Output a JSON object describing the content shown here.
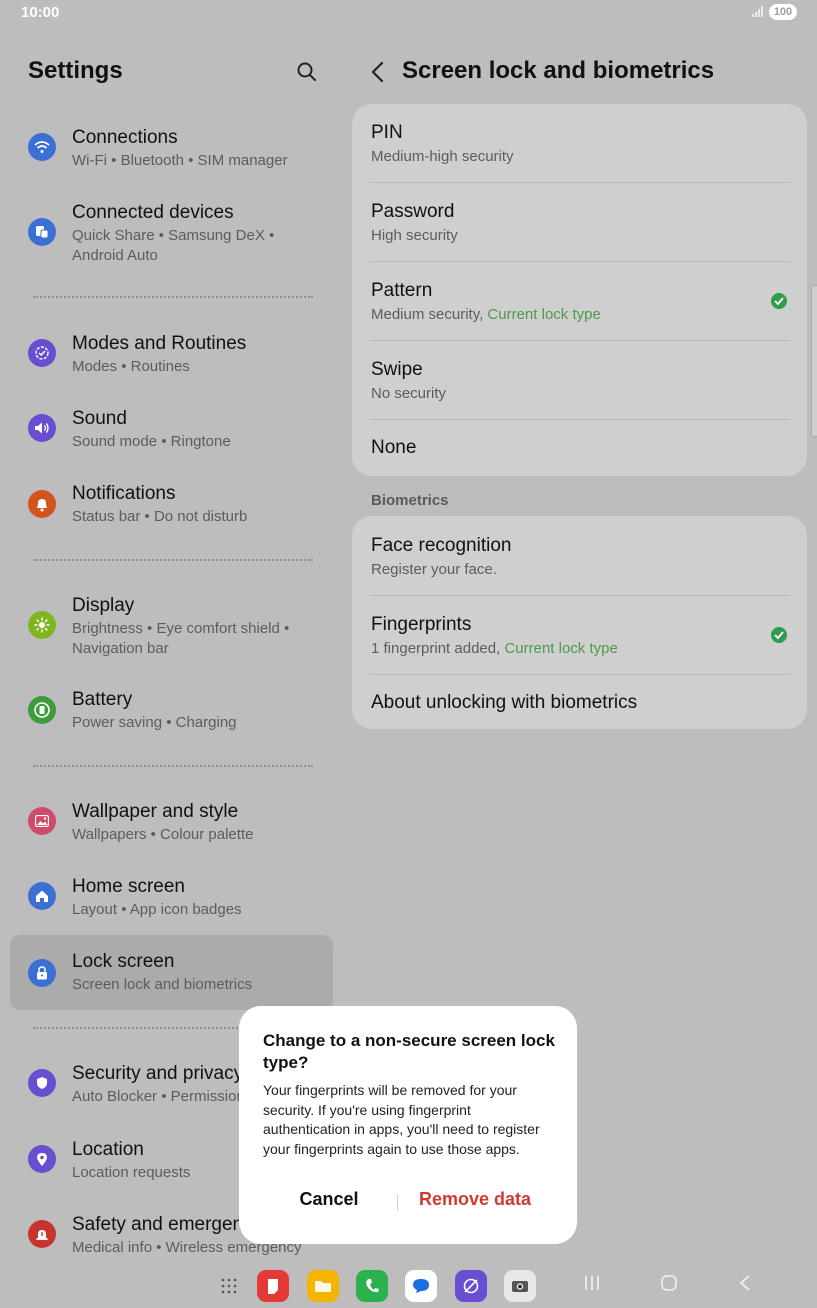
{
  "status_bar": {
    "time": "10:00",
    "battery": "100"
  },
  "left": {
    "title": "Settings",
    "items": [
      {
        "title": "Connections",
        "subtitle": "Wi-Fi  •  Bluetooth  •  SIM manager",
        "icon": "wifi-icon",
        "color": "#3b6fd4"
      },
      {
        "title": "Connected devices",
        "subtitle": "Quick Share  •  Samsung DeX  •  Android Auto",
        "icon": "devices-icon",
        "color": "#3b6fd4"
      },
      {
        "title": "Modes and Routines",
        "subtitle": "Modes  •  Routines",
        "icon": "routines-icon",
        "color": "#6a4ed1"
      },
      {
        "title": "Sound",
        "subtitle": "Sound mode  •  Ringtone",
        "icon": "speaker-icon",
        "color": "#6a4ed1"
      },
      {
        "title": "Notifications",
        "subtitle": "Status bar  •  Do not disturb",
        "icon": "bell-icon",
        "color": "#d4541f"
      },
      {
        "title": "Display",
        "subtitle": "Brightness  •  Eye comfort shield  •  Navigation bar",
        "icon": "sun-icon",
        "color": "#7fb51f"
      },
      {
        "title": "Battery",
        "subtitle": "Power saving  •  Charging",
        "icon": "battery-icon",
        "color": "#3d9a3d"
      },
      {
        "title": "Wallpaper and style",
        "subtitle": "Wallpapers  •  Colour palette",
        "icon": "wallpaper-icon",
        "color": "#d14a6a"
      },
      {
        "title": "Home screen",
        "subtitle": "Layout  •  App icon badges",
        "icon": "home-icon",
        "color": "#3b6fd4"
      },
      {
        "title": "Lock screen",
        "subtitle": "Screen lock and biometrics",
        "icon": "lock-icon",
        "color": "#3b6fd4"
      },
      {
        "title": "Security and privacy",
        "subtitle": "Auto Blocker  •  Permissions",
        "icon": "shield-icon",
        "color": "#6a4ed1"
      },
      {
        "title": "Location",
        "subtitle": "Location requests",
        "icon": "location-pin-icon",
        "color": "#6a4ed1"
      },
      {
        "title": "Safety and emergency",
        "subtitle": "Medical info  •  Wireless emergency",
        "icon": "emergency-icon",
        "color": "#c7342e"
      }
    ]
  },
  "right": {
    "title": "Screen lock and biometrics",
    "lock_types": [
      {
        "title": "PIN",
        "subtitle": "Medium-high security"
      },
      {
        "title": "Password",
        "subtitle": "High security"
      },
      {
        "title": "Pattern",
        "subtitle": "Medium security, ",
        "accent": "Current lock type"
      },
      {
        "title": "Swipe",
        "subtitle": "No security"
      },
      {
        "title": "None"
      }
    ],
    "biometrics_label": "Biometrics",
    "biometrics": [
      {
        "title": "Face recognition",
        "subtitle": "Register your face."
      },
      {
        "title": "Fingerprints",
        "subtitle": "1 fingerprint added, ",
        "accent": "Current lock type"
      },
      {
        "title": "About unlocking with biometrics"
      }
    ]
  },
  "dialog": {
    "title": "Change to a non-secure screen lock type?",
    "body": "Your fingerprints will be removed for your security. If you're using fingerprint authentication in apps, you'll need to register your fingerprints again to use those apps.",
    "cancel": "Cancel",
    "confirm": "Remove data"
  },
  "taskbar": {
    "apps": [
      {
        "name": "app-drawer-icon"
      },
      {
        "name": "notes-app-icon",
        "color": "#e53935"
      },
      {
        "name": "files-app-icon",
        "color": "#f5b400"
      },
      {
        "name": "phone-app-icon",
        "color": "#2bb24c"
      },
      {
        "name": "messages-app-icon",
        "color": "#ffffff"
      },
      {
        "name": "internet-app-icon",
        "color": "#6a4ed1"
      },
      {
        "name": "camera-app-icon",
        "color": "#e8e8e8"
      }
    ]
  }
}
